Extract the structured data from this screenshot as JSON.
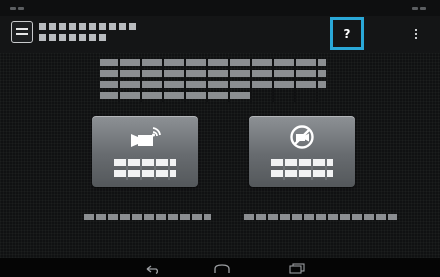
{
  "action_bar": {
    "app_icon_text": "Cam Ctrl",
    "help_label": "?"
  },
  "icons": {
    "app": "camera-control-app-icon",
    "help": "help-icon",
    "overflow": "overflow-menu-icon",
    "remote_record": "wireless-video-camera-icon",
    "disconnect": "no-remote-camera-icon",
    "back": "back-icon",
    "home": "home-icon",
    "recents": "recent-apps-icon"
  },
  "colors": {
    "help_highlight": "#2aa8d8",
    "button_face": "#74787c",
    "background": "#101112",
    "obscured_text": "#8b8e91"
  }
}
